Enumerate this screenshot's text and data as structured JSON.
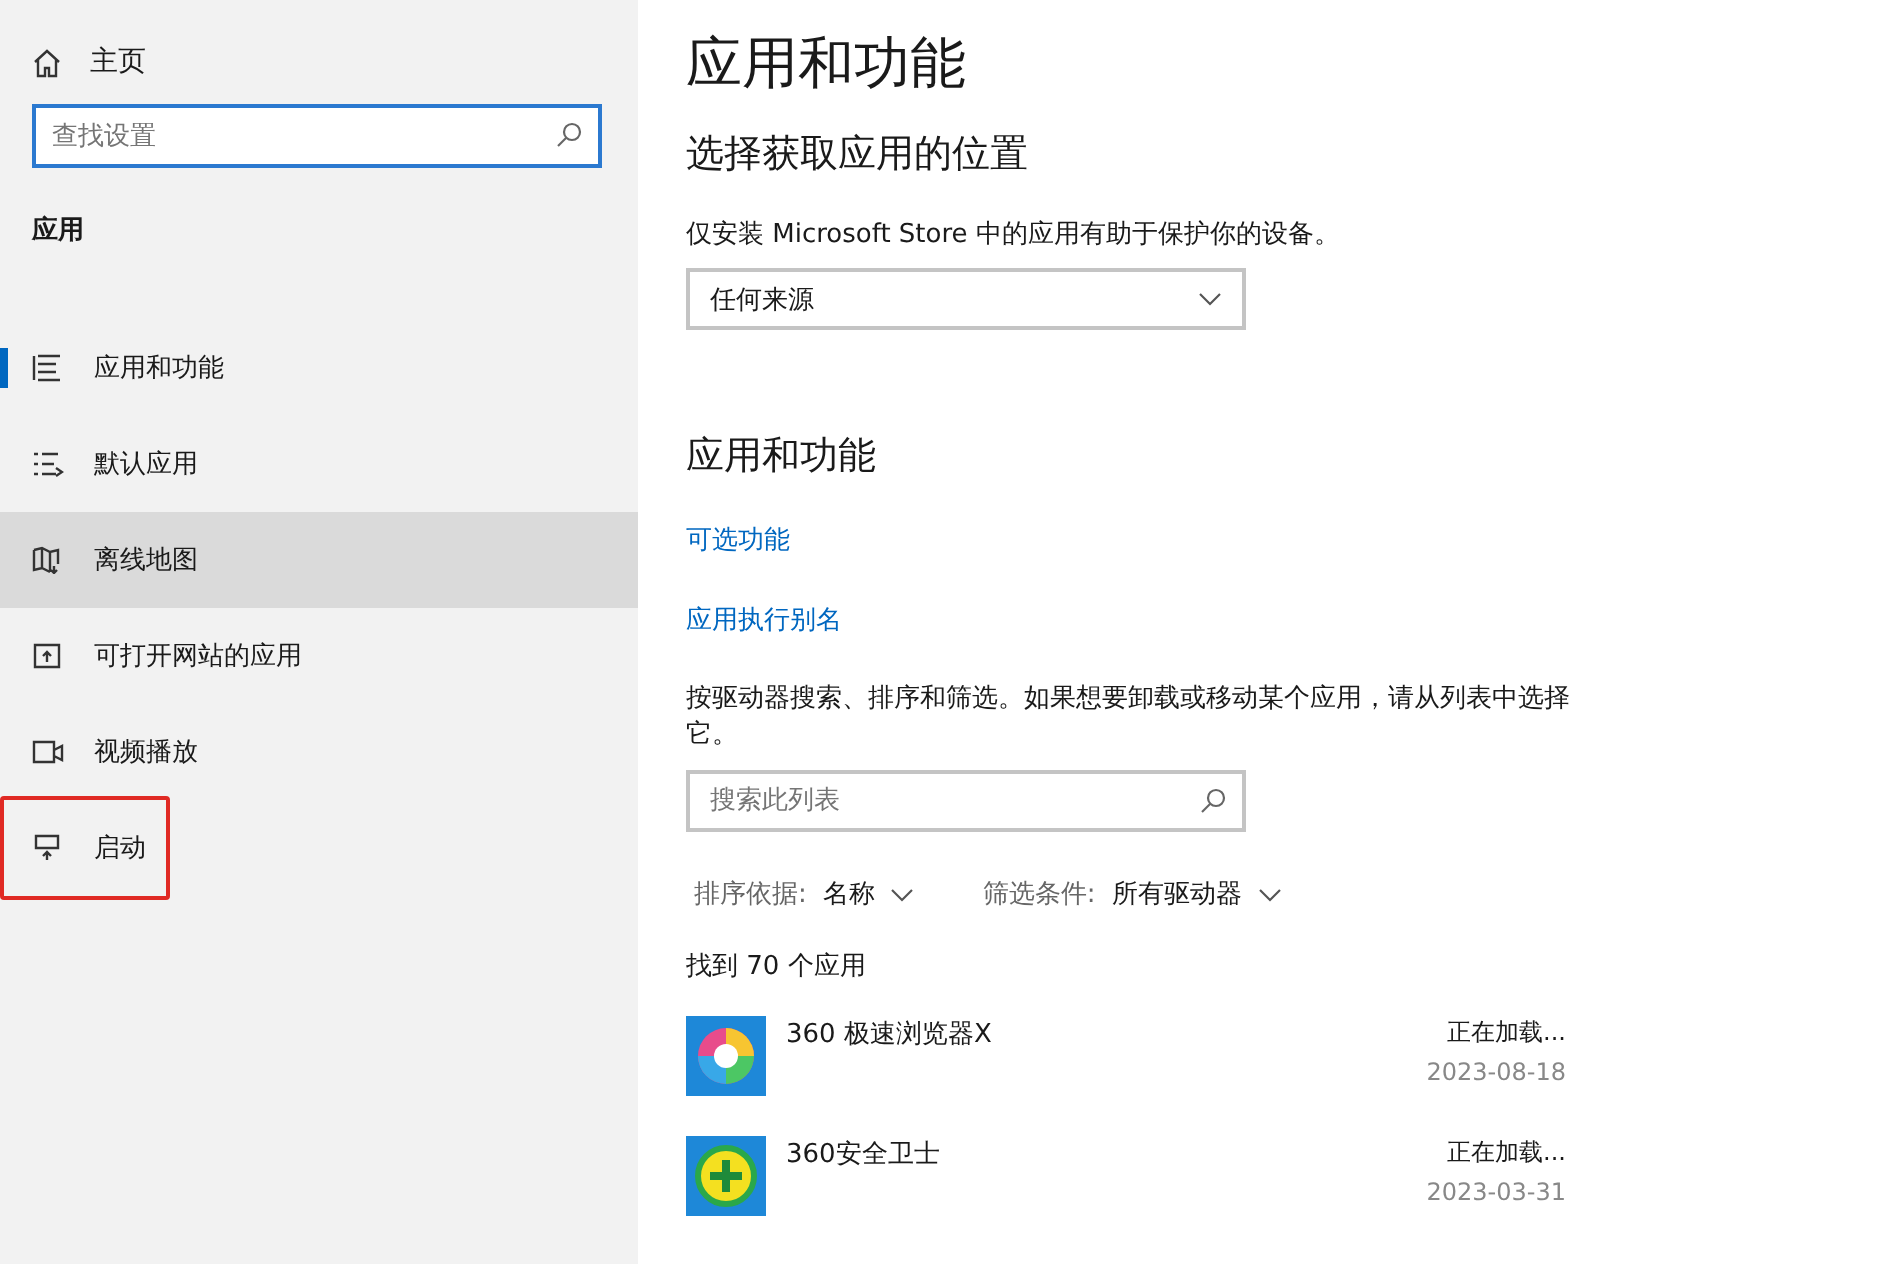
{
  "sidebar": {
    "home": "主页",
    "search": {
      "placeholder": "查找设置"
    },
    "section": "应用",
    "items": [
      {
        "label": "应用和功能",
        "kind": "list",
        "selected": true,
        "hovered": false,
        "highlighted": false
      },
      {
        "label": "默认应用",
        "kind": "default",
        "selected": false,
        "hovered": false,
        "highlighted": false
      },
      {
        "label": "离线地图",
        "kind": "map",
        "selected": false,
        "hovered": true,
        "highlighted": false
      },
      {
        "label": "可打开网站的应用",
        "kind": "web",
        "selected": false,
        "hovered": false,
        "highlighted": false
      },
      {
        "label": "视频播放",
        "kind": "video",
        "selected": false,
        "hovered": false,
        "highlighted": false
      },
      {
        "label": "启动",
        "kind": "startup",
        "selected": false,
        "hovered": false,
        "highlighted": true
      }
    ]
  },
  "main": {
    "title": "应用和功能",
    "source_heading": "选择获取应用的位置",
    "source_description": "仅安装 Microsoft Store 中的应用有助于保护你的设备。",
    "source_dropdown": "任何来源",
    "apps_heading": "应用和功能",
    "links": [
      "可选功能",
      "应用执行别名"
    ],
    "list_description": "按驱动器搜索、排序和筛选。如果想要卸载或移动某个应用，请从列表中选择它。",
    "list_search": {
      "placeholder": "搜索此列表"
    },
    "sort": {
      "label": "排序依据:",
      "value": "名称"
    },
    "filter": {
      "label": "筛选条件:",
      "value": "所有驱动器"
    },
    "count": "找到 70 个应用",
    "apps": [
      {
        "name": "360 极速浏览器X",
        "kind": "browser",
        "status": "正在加载...",
        "date": "2023-08-18"
      },
      {
        "name": "360安全卫士",
        "kind": "security",
        "status": "正在加载...",
        "date": "2023-03-31"
      }
    ]
  }
}
